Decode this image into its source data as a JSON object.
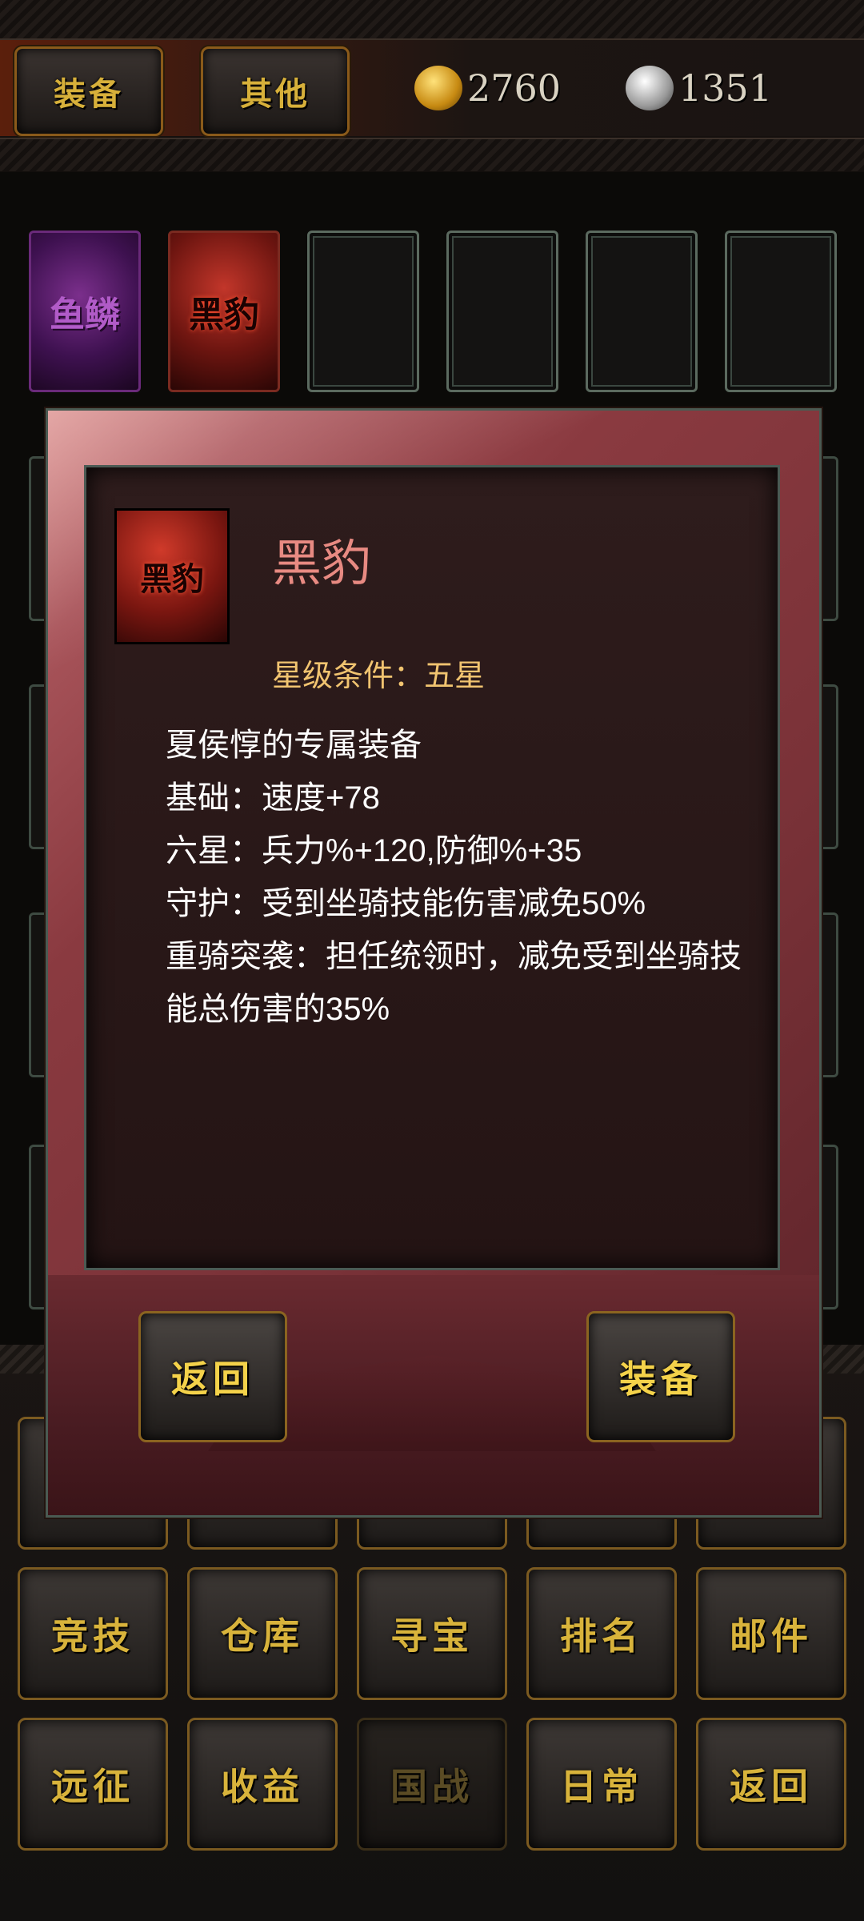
{
  "top_bar": {
    "tab_equipment": "装备",
    "tab_other": "其他",
    "gold": "2760",
    "silver": "1351"
  },
  "slots": [
    {
      "label": "鱼鳞",
      "rarity": "purple"
    },
    {
      "label": "黑豹",
      "rarity": "red"
    },
    {
      "label": ""
    },
    {
      "label": ""
    },
    {
      "label": ""
    },
    {
      "label": ""
    }
  ],
  "bottom_menu": {
    "row2": [
      "竞技",
      "仓库",
      "寻宝",
      "排名",
      "邮件"
    ],
    "row3": [
      "远征",
      "收益",
      "国战",
      "日常",
      "返回"
    ]
  },
  "dialog": {
    "icon_label": "黑豹",
    "name": "黑豹",
    "star_requirement": "星级条件：五星",
    "desc": {
      "line1": "夏侯惇的专属装备",
      "line2": "基础：速度+78",
      "line3": "六星：兵力%+120,防御%+35",
      "line4": "守护：受到坐骑技能伤害减免50%",
      "line5": "重骑突袭：担任统领时，减免受到坐骑技能总伤害的35%"
    },
    "back_label": "返回",
    "equip_label": "装备"
  },
  "colors": {
    "gold_text": "#d8b33b",
    "item_name": "#e88a82",
    "star_text": "#f1c470",
    "dialog_frame": "#8a3a40"
  }
}
